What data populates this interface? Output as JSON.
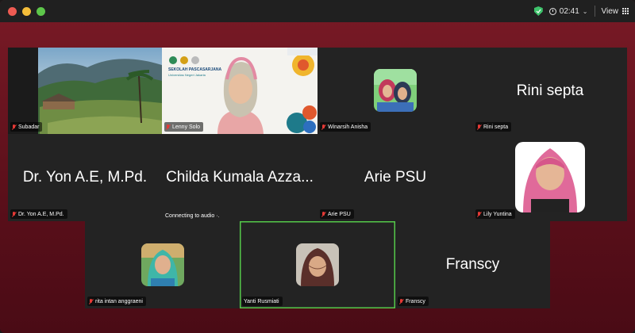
{
  "titlebar": {
    "timer": "02:41",
    "view_label": "View"
  },
  "participants": [
    {
      "id": "subadar",
      "label": "Subadar"
    },
    {
      "id": "lenny",
      "label": "Lenny Solo"
    },
    {
      "id": "winarsih",
      "label": "Winarsih Anisha"
    },
    {
      "id": "rini",
      "label": "Rini septa",
      "big": "Rini septa"
    },
    {
      "id": "yon",
      "label": "Dr. Yon A.E, M.Pd.",
      "big": "Dr. Yon A.E, M.Pd."
    },
    {
      "id": "childa",
      "big": "Childa Kumala Azza...",
      "status": "Connecting to audio"
    },
    {
      "id": "arie",
      "label": "Arie PSU",
      "big": "Arie PSU"
    },
    {
      "id": "lily",
      "label": "Lily Yuntina"
    },
    {
      "id": "rita",
      "label": "rita intan anggraeni"
    },
    {
      "id": "yanti",
      "label": "Yanti Rusmiati"
    },
    {
      "id": "franscy",
      "label": "Franscy",
      "big": "Franscy"
    }
  ],
  "slide": {
    "school_title": "SEKOLAH PASCASARJANA",
    "school_subtitle": "Universitas Negeri Jakarta"
  },
  "colors": {
    "background": "#6b1421",
    "tile": "#232323",
    "active_speaker": "#55c94a",
    "muted_mic": "#e53935"
  }
}
